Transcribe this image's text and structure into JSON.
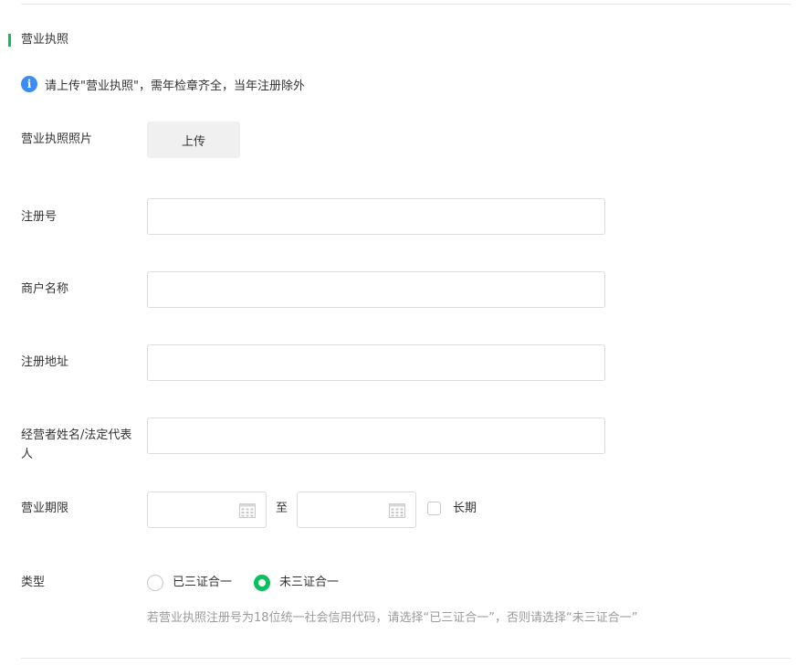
{
  "section": {
    "title": "营业执照",
    "accent_color": "#07c160"
  },
  "notice": {
    "icon": "info-icon",
    "icon_glyph": "i",
    "text": "请上传\"营业执照\"，需年检章齐全，当年注册除外"
  },
  "fields": {
    "license_photo": {
      "label": "营业执照照片",
      "button_label": "上传"
    },
    "reg_number": {
      "label": "注册号",
      "value": ""
    },
    "merchant_name": {
      "label": "商户名称",
      "value": ""
    },
    "reg_address": {
      "label": "注册地址",
      "value": ""
    },
    "legal_rep": {
      "label": "经营者姓名/法定代表人",
      "value": ""
    },
    "business_term": {
      "label": "营业期限",
      "start_value": "",
      "to_label": "至",
      "end_value": "",
      "long_term_label": "长期",
      "long_term_checked": false
    },
    "type": {
      "label": "类型",
      "options": [
        "已三证合一",
        "未三证合一"
      ],
      "selected": "未三证合一",
      "hint": "若营业执照注册号为18位统一社会信用代码，请选择“已三证合一”，否则请选择“未三证合一”"
    }
  }
}
